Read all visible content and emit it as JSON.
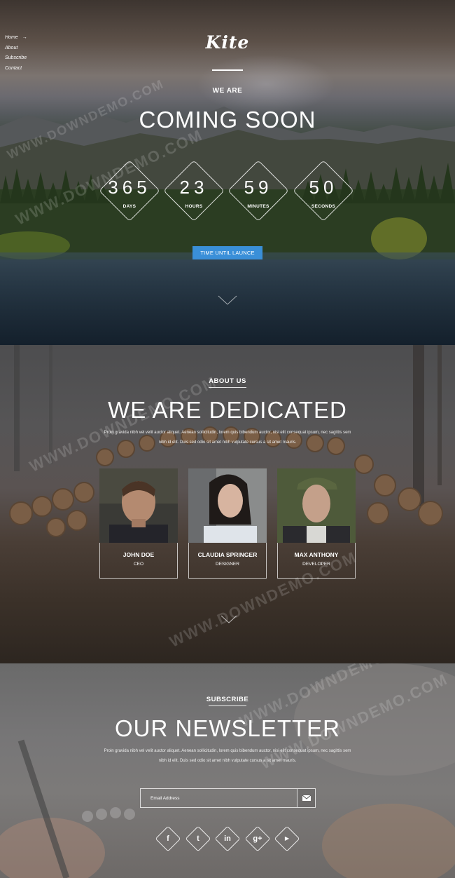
{
  "nav": {
    "items": [
      "Home",
      "About",
      "Subscribe",
      "Contact"
    ],
    "active_arrow": "→"
  },
  "hero": {
    "logo": "Kite",
    "we_are": "WE ARE",
    "title": "COMING SOON",
    "countdown": [
      {
        "value": "365",
        "label": "DAYS"
      },
      {
        "value": "23",
        "label": "HOURS"
      },
      {
        "value": "59",
        "label": "MINUTES"
      },
      {
        "value": "50",
        "label": "SECONDS"
      }
    ],
    "launch_button": "TIME UNTIL LAUNCE"
  },
  "about": {
    "label": "ABOUT US",
    "title": "WE ARE DEDICATED",
    "text_line1": "Proin gravida nibh vel velit auctor aliquet. Aenean sollicitudin, lorem quis bibendum auctor, nisi elit consequat ipsum, nec sagittis sem",
    "text_line2": "nibh id elit. Duis sed odio sit amet nibh vulputate cursus a sit amet mauris.",
    "team": [
      {
        "name": "JOHN DOE",
        "role": "CEO"
      },
      {
        "name": "CLAUDIA SPRINGER",
        "role": "DESIGNER"
      },
      {
        "name": "MAX ANTHONY",
        "role": "DEVELOPER"
      }
    ]
  },
  "subscribe": {
    "label": "SUBSCRIBE",
    "title": "OUR NEWSLETTER",
    "text_line1": "Proin gravida nibh vel velit auctor aliquet. Aenean sollicitudin, lorem quis bibendum auctor, nisi elit consequat ipsum, nec sagittis sem",
    "text_line2": "nibh id elit. Duis sed odio sit amet nibh vulputate cursus a sit amet mauris.",
    "email_placeholder": "Email Address",
    "socials": [
      {
        "icon": "facebook-icon",
        "glyph": "f"
      },
      {
        "icon": "twitter-icon",
        "glyph": "t"
      },
      {
        "icon": "linkedin-icon",
        "glyph": "in"
      },
      {
        "icon": "google-plus-icon",
        "glyph": "g+"
      },
      {
        "icon": "youtube-icon",
        "glyph": "▶"
      }
    ]
  },
  "watermark": "WWW.DOWNDEMO.COM",
  "colors": {
    "accent": "#3a8fd8"
  }
}
